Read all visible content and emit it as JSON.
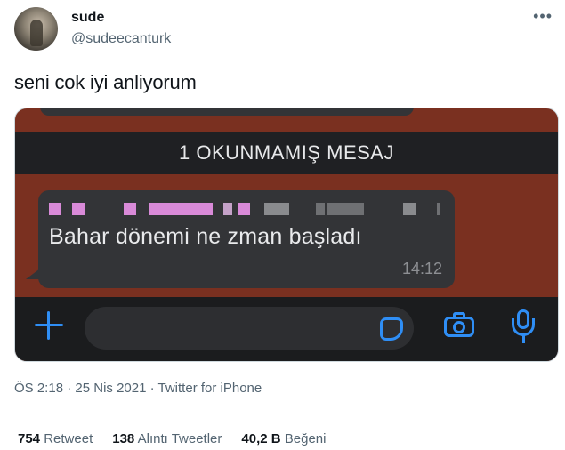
{
  "author": {
    "name": "sude",
    "handle": "@sudeecanturk"
  },
  "tweet": {
    "text": "seni cok iyi anliyorum"
  },
  "screenshot": {
    "unread_banner": "1 OKUNMAMIŞ MESAJ",
    "message": {
      "text": "Bahar dönemi ne zman başladı",
      "time": "14:12"
    },
    "colors": {
      "background": "#7a3020",
      "bubble": "#333437",
      "accent": "#2f8ef5"
    }
  },
  "meta": {
    "time": "ÖS 2:18",
    "date": "25 Nis 2021",
    "source": "Twitter for iPhone"
  },
  "stats": {
    "retweets_count": "754",
    "retweets_label": "Retweet",
    "quotes_count": "138",
    "quotes_label": "Alıntı Tweetler",
    "likes_count": "40,2 B",
    "likes_label": "Beğeni"
  }
}
